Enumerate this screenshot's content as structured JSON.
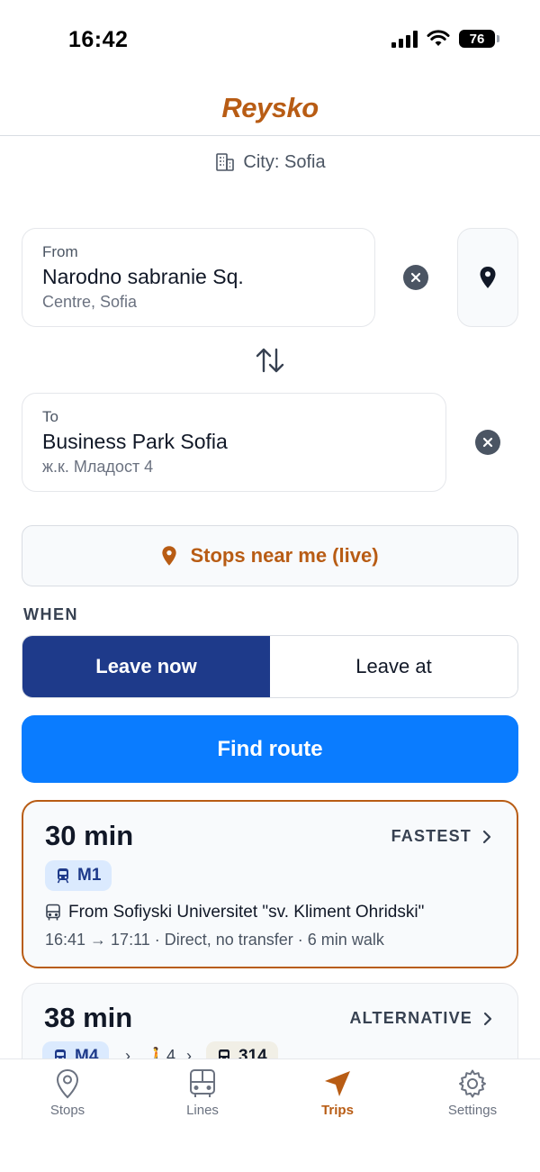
{
  "status_bar": {
    "time": "16:42",
    "battery": "76"
  },
  "header": {
    "app_name": "Reysko"
  },
  "city": {
    "label": "City: Sofia"
  },
  "from": {
    "label": "From",
    "name": "Narodno sabranie Sq.",
    "area": "Centre, Sofia"
  },
  "to": {
    "label": "To",
    "name": "Business Park Sofia",
    "area": "ж.к. Младост 4"
  },
  "stops_near": {
    "label": "Stops near me (live)"
  },
  "when": {
    "label": "WHEN",
    "options": [
      "Leave now",
      "Leave at"
    ],
    "selected": "Leave now"
  },
  "find_route": {
    "label": "Find route"
  },
  "trips": [
    {
      "duration": "30 min",
      "badge": "FASTEST",
      "lines": [
        "M1"
      ],
      "from_text": "From Sofiyski Universitet \"sv. Kliment Ohridski\"",
      "meta": "16:41 → 17:11 · Direct, no transfer · 6 min walk"
    },
    {
      "duration": "38 min",
      "badge": "ALTERNATIVE",
      "lines": [
        "M4",
        "314"
      ],
      "walk_minutes": "4"
    }
  ],
  "tabs": [
    {
      "label": "Stops",
      "icon": "map-pin-icon"
    },
    {
      "label": "Lines",
      "icon": "bus-icon"
    },
    {
      "label": "Trips",
      "icon": "navigation-arrow-icon",
      "active": true
    },
    {
      "label": "Settings",
      "icon": "gear-icon"
    }
  ],
  "colors": {
    "brand": "#b85c14",
    "primary": "#0a7cff",
    "segment_active": "#1e3a8a"
  }
}
